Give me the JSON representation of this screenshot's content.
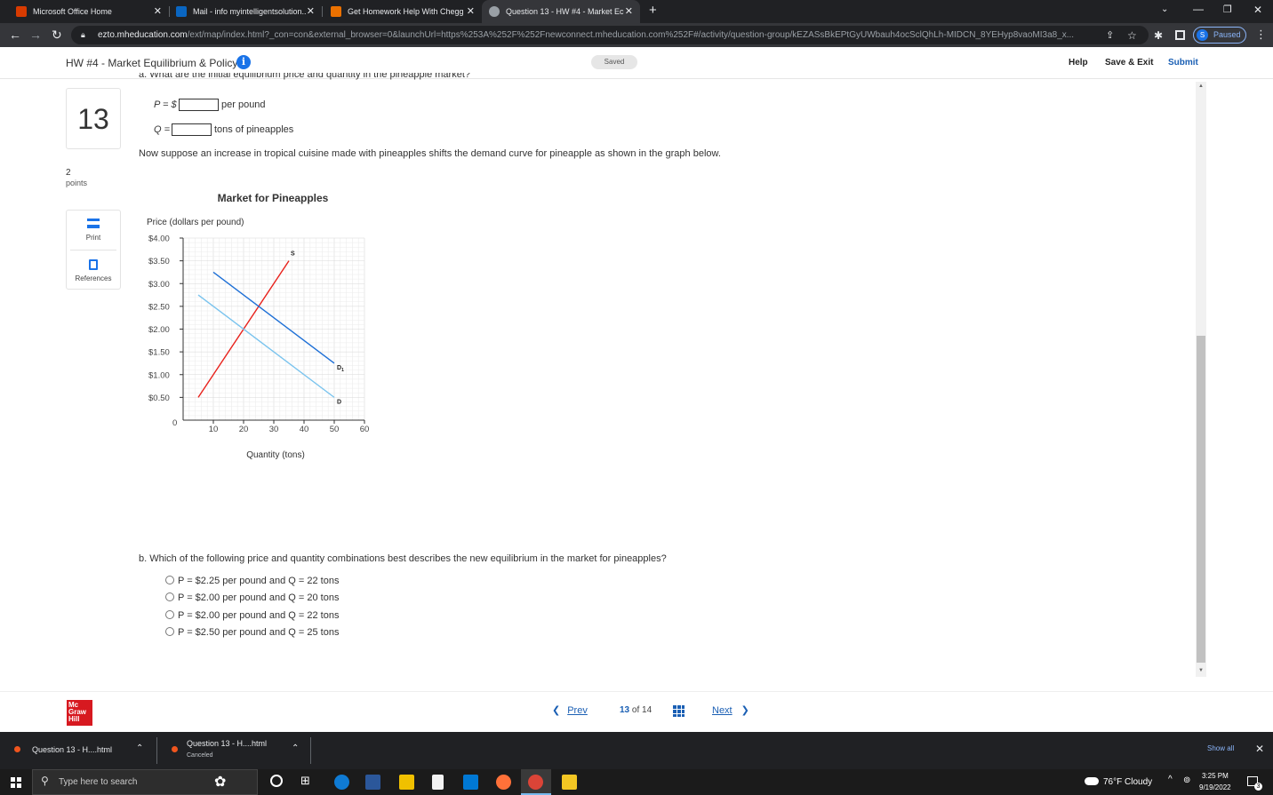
{
  "browser": {
    "tabs": [
      {
        "title": "Microsoft Office Home",
        "color": "#d83b01"
      },
      {
        "title": "Mail - info myintelligentsolution...",
        "color": "#0a66c2"
      },
      {
        "title": "Get Homework Help With Chegg",
        "color": "#eb7100"
      },
      {
        "title": "Question 13 - HW #4 - Market Ec",
        "color": "#9aa0a6"
      }
    ],
    "new_tab": "+",
    "url_host": "ezto.mheducation.com",
    "url_rest": "/ext/map/index.html?_con=con&external_browser=0&launchUrl=https%253A%252F%252Fnewconnect.mheducation.com%252F#/activity/question-group/kEZASsBkEPtGyUWbauh4ocSclQhLh-MIDCN_8YEHyp8vaoMI3a8_x...",
    "profile_label": "Paused",
    "profile_initial": "S"
  },
  "header": {
    "title": "HW #4 - Market Equilibrium & Policy",
    "saved": "Saved",
    "help": "Help",
    "save_exit": "Save & Exit",
    "submit": "Submit"
  },
  "sidebar": {
    "question_number": "13",
    "points_value": "2",
    "points_label": "points",
    "print": "Print",
    "references": "References"
  },
  "question": {
    "part_a_cut": "a. What are the initial equilibrium price and quantity in the pineapple market?",
    "p_label": "P = $",
    "p_unit": "per pound",
    "p_value": "",
    "q_label": "Q =",
    "q_unit": "tons of pineapples",
    "q_value": "",
    "shift_text": "Now suppose an increase in tropical cuisine made with pineapples shifts the demand curve for pineapple as shown in the graph below.",
    "part_b": "b. Which of the following price and quantity combinations best describes the new equilibrium in the market for pineapples?",
    "options": [
      "P = $2.25 per pound and Q = 22 tons",
      "P = $2.00 per pound and Q = 20 tons",
      "P = $2.00 per pound and Q = 22 tons",
      "P = $2.50 per pound and Q = 25 tons"
    ]
  },
  "chart_data": {
    "type": "line",
    "title": "Market for Pineapples",
    "ylabel": "Price (dollars per pound)",
    "xlabel": "Quantity (tons)",
    "xlim": [
      0,
      60
    ],
    "ylim": [
      0,
      4
    ],
    "xticks": [
      10,
      20,
      30,
      40,
      50,
      60
    ],
    "xtick_labels": [
      "10",
      "20",
      "30",
      "40",
      "50",
      "60"
    ],
    "yticks": [
      0.5,
      1,
      1.5,
      2,
      2.5,
      3,
      3.5,
      4
    ],
    "ytick_labels": [
      "$0.50",
      "$1.00",
      "$1.50",
      "$2.00",
      "$2.50",
      "$3.00",
      "$3.50",
      "$4.00"
    ],
    "origin_label": "0",
    "grid": true,
    "series": [
      {
        "name": "S",
        "color": "#e8211b",
        "x": [
          5,
          35
        ],
        "y": [
          0.5,
          3.5
        ]
      },
      {
        "name": "D",
        "color": "#79c3ee",
        "x": [
          5,
          50
        ],
        "y": [
          2.75,
          0.5
        ]
      },
      {
        "name": "D1",
        "color": "#1d6fd6",
        "x": [
          10,
          50
        ],
        "y": [
          3.25,
          1.25
        ]
      }
    ]
  },
  "footer": {
    "prev": "Prev",
    "page_current": "13",
    "page_of": "of",
    "page_total": "14",
    "next": "Next",
    "logo": [
      "Mc",
      "Graw",
      "Hill"
    ]
  },
  "downloads": [
    {
      "name": "Question 13 - H....html",
      "status": ""
    },
    {
      "name": "Question 13 - H....html",
      "status": "Canceled"
    }
  ],
  "downloads_show_all": "Show all",
  "taskbar": {
    "search_placeholder": "Type here to search",
    "weather": "76°F  Cloudy",
    "time": "3:25 PM",
    "date": "9/19/2022",
    "notif_count": "3"
  }
}
